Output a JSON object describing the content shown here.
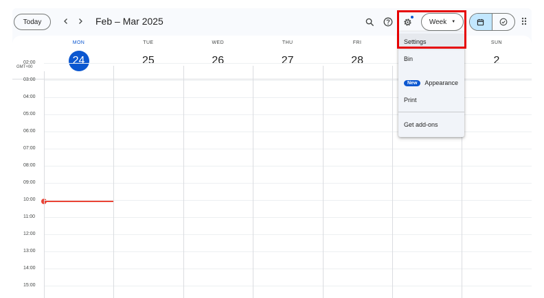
{
  "header": {
    "today_label": "Today",
    "prev_label": "‹",
    "next_label": "›",
    "date_range": "Feb – Mar 2025",
    "view_label": "Week"
  },
  "days": [
    {
      "name": "MON",
      "num": "24",
      "today": true
    },
    {
      "name": "TUE",
      "num": "25",
      "today": false
    },
    {
      "name": "WED",
      "num": "26",
      "today": false
    },
    {
      "name": "THU",
      "num": "27",
      "today": false
    },
    {
      "name": "FRI",
      "num": "28",
      "today": false
    },
    {
      "name": "",
      "num": "",
      "today": false
    },
    {
      "name": "SUN",
      "num": "2",
      "today": false
    }
  ],
  "timezone": "GMT+00",
  "times": [
    "02:00",
    "03:00",
    "04:00",
    "05:00",
    "06:00",
    "07:00",
    "08:00",
    "09:00",
    "10:00",
    "11:00",
    "12:00",
    "13:00",
    "14:00",
    "15:00"
  ],
  "menu": {
    "settings": "Settings",
    "bin": "Bin",
    "new_badge": "New",
    "appearance": "Appearance",
    "print": "Print",
    "addons": "Get add-ons"
  },
  "colors": {
    "accent": "#0b57d0",
    "current_time": "#ea4335",
    "highlight": "#e60000"
  }
}
